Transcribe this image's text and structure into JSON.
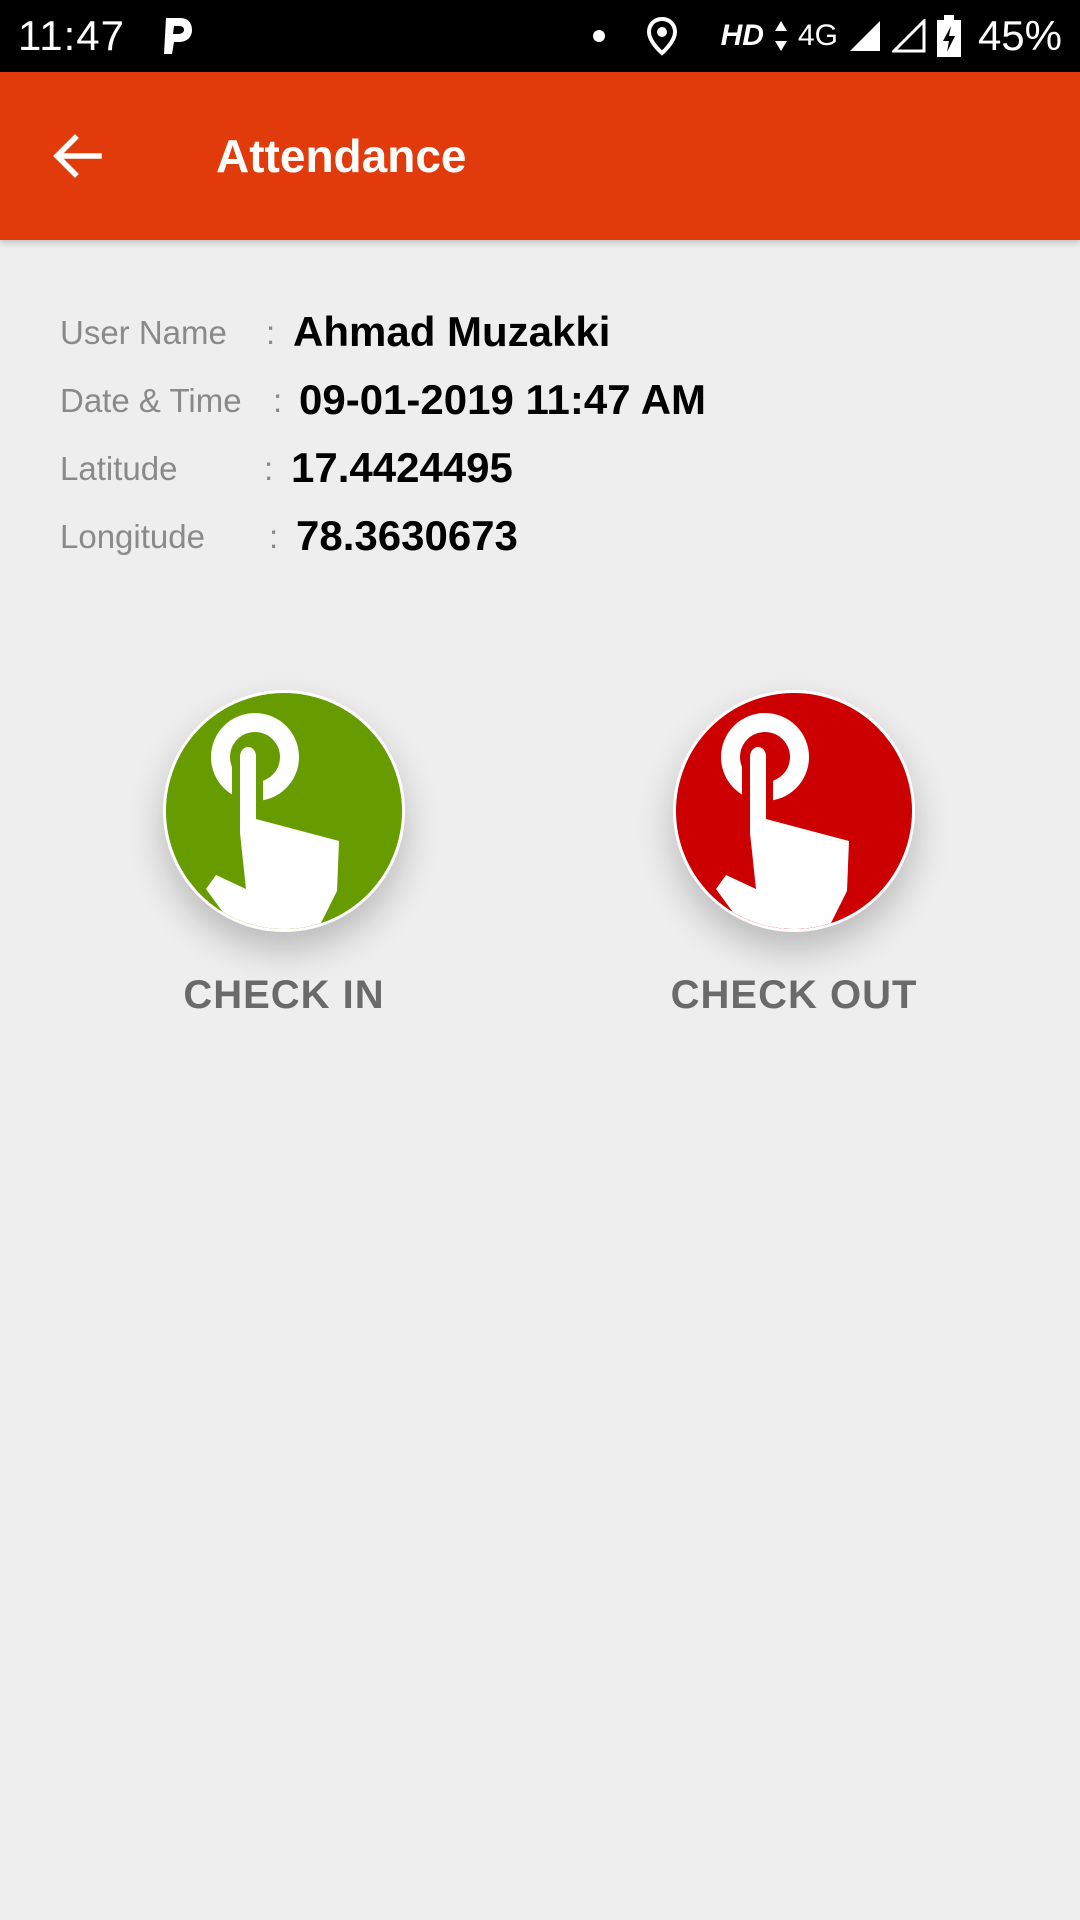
{
  "status_bar": {
    "time": "11:47",
    "hd": "HD",
    "network": "4G",
    "battery": "45%"
  },
  "app_bar": {
    "title": "Attendance"
  },
  "info": {
    "rows": [
      {
        "label": "User Name",
        "value": "Ahmad Muzakki"
      },
      {
        "label": "Date & Time",
        "value": "09-01-2019 11:47 AM"
      },
      {
        "label": "Latitude",
        "value": "17.4424495"
      },
      {
        "label": "Longitude",
        "value": "78.3630673"
      }
    ],
    "separator": ":"
  },
  "actions": {
    "check_in": {
      "label": "CHECK IN",
      "color": "#679c00",
      "icon": "tap-hand-icon"
    },
    "check_out": {
      "label": "CHECK OUT",
      "color": "#cc0000",
      "icon": "tap-hand-icon"
    }
  },
  "colors": {
    "app_bar": "#e23b0b",
    "background": "#eeeeee"
  }
}
